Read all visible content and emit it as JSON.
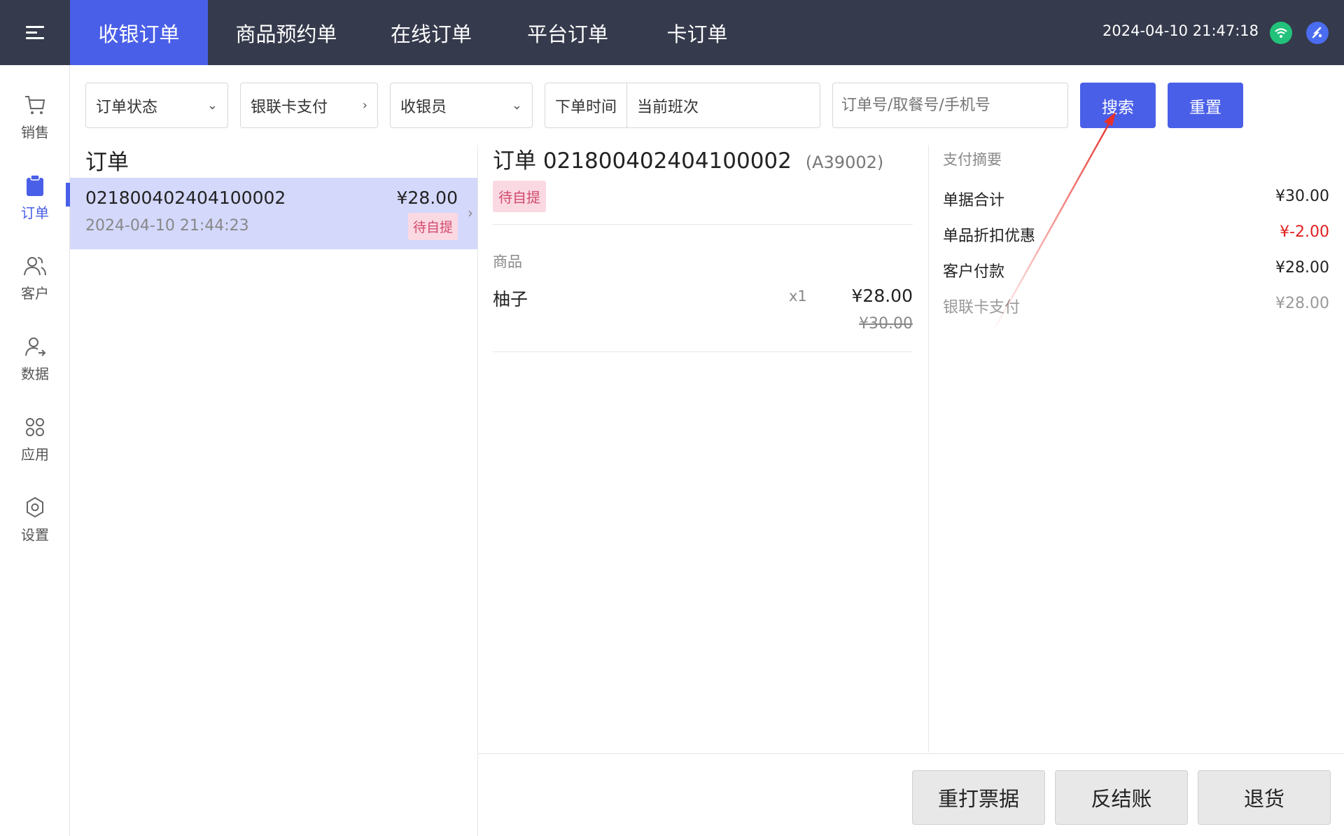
{
  "topbar": {
    "tabs": [
      {
        "label": "收银订单",
        "active": true
      },
      {
        "label": "商品预约单",
        "active": false
      },
      {
        "label": "在线订单",
        "active": false
      },
      {
        "label": "平台订单",
        "active": false
      },
      {
        "label": "卡订单",
        "active": false
      }
    ],
    "datetime": "2024-04-10 21:47:18",
    "icons": [
      "wifi-icon",
      "app-logo-icon"
    ]
  },
  "sidebar": {
    "items": [
      {
        "label": "销售",
        "icon": "cart-icon",
        "active": false
      },
      {
        "label": "订单",
        "icon": "clipboard-icon",
        "active": true
      },
      {
        "label": "客户",
        "icon": "users-icon",
        "active": false
      },
      {
        "label": "数据",
        "icon": "user-data-icon",
        "active": false
      },
      {
        "label": "应用",
        "icon": "apps-grid-icon",
        "active": false
      },
      {
        "label": "设置",
        "icon": "gear-icon",
        "active": false
      }
    ]
  },
  "filters": {
    "status": "订单状态",
    "payment": "银联卡支付",
    "cashier": "收银员",
    "time_label": "下单时间",
    "time_value": "当前班次",
    "search_placeholder": "订单号/取餐号/手机号",
    "search_button": "搜索",
    "reset_button": "重置"
  },
  "order_list": {
    "title": "订单",
    "orders": [
      {
        "number": "021800402404100002",
        "amount": "¥28.00",
        "time": "2024-04-10 21:44:23",
        "status": "待自提"
      }
    ]
  },
  "detail": {
    "title_prefix": "订单",
    "order_number": "021800402404100002",
    "pickup_code": "(A39002)",
    "status": "待自提",
    "goods_label": "商品",
    "items": [
      {
        "name": "柚子",
        "qty": "x1",
        "price": "¥28.00",
        "original_price": "¥30.00"
      }
    ]
  },
  "payment_summary": {
    "title": "支付摘要",
    "rows": [
      {
        "label": "单据合计",
        "value": "¥30.00",
        "color": "#222222"
      },
      {
        "label": "单品折扣优惠",
        "value": "¥-2.00",
        "color": "#e02020"
      },
      {
        "label": "客户付款",
        "value": "¥28.00",
        "color": "#222222"
      },
      {
        "label": "银联卡支付",
        "value": "¥28.00",
        "color": "#999999"
      }
    ]
  },
  "actions": {
    "reprint": "重打票据",
    "reverse": "反结账",
    "refund": "退货"
  },
  "colors": {
    "topbar": "#353a4c",
    "accent": "#4a5fe8",
    "selected_row": "#d4d8fb",
    "annotation_arrow": "#e8302a"
  }
}
